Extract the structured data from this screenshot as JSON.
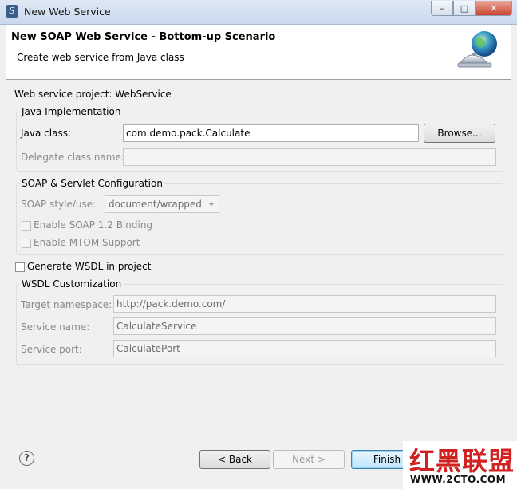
{
  "window": {
    "title": "New Web Service",
    "controls": {
      "minimize": "–",
      "maximize": "□",
      "close": "✕"
    }
  },
  "banner": {
    "title": "New SOAP Web Service - Bottom-up Scenario",
    "subtitle": "Create web service from Java class",
    "icon": "globe-bell-icon"
  },
  "project": {
    "label": "Web service project: WebService"
  },
  "java_impl": {
    "group_title": "Java Implementation",
    "java_class_label": "Java class:",
    "java_class_value": "com.demo.pack.Calculate",
    "browse_label": "Browse...",
    "delegate_label": "Delegate class name:",
    "delegate_value": ""
  },
  "soap_config": {
    "group_title": "SOAP & Servlet Configuration",
    "style_label": "SOAP style/use:",
    "style_value": "document/wrapped",
    "soap12_label": "Enable SOAP 1.2 Binding",
    "mtom_label": "Enable MTOM Support"
  },
  "wsdl": {
    "generate_label": "Generate WSDL in project",
    "group_title": "WSDL Customization",
    "namespace_label": "Target namespace:",
    "namespace_value": "http://pack.demo.com/",
    "service_name_label": "Service name:",
    "service_name_value": "CalculateService",
    "service_port_label": "Service port:",
    "service_port_value": "CalculatePort"
  },
  "footer": {
    "help_icon": "help-icon",
    "back_label": "< Back",
    "next_label": "Next >",
    "finish_label": "Finish"
  },
  "watermark": {
    "logo": "红黑联盟",
    "url": "WWW.2CTO.COM"
  }
}
